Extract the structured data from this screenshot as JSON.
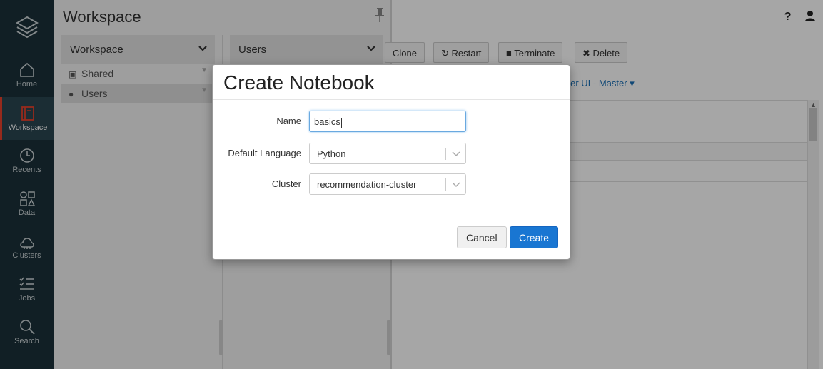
{
  "nav": {
    "items": [
      {
        "label": "Home",
        "icon": "home-icon"
      },
      {
        "label": "Workspace",
        "icon": "workspace-icon"
      },
      {
        "label": "Recents",
        "icon": "clock-icon"
      },
      {
        "label": "Data",
        "icon": "data-icon"
      },
      {
        "label": "Clusters",
        "icon": "cluster-icon"
      },
      {
        "label": "Jobs",
        "icon": "jobs-icon"
      },
      {
        "label": "Search",
        "icon": "search-icon"
      }
    ],
    "active": "Workspace",
    "accent_color": "#e8412c",
    "background_color": "#1b3139"
  },
  "workspace": {
    "title": "Workspace",
    "col1": {
      "header": "Workspace",
      "items": [
        {
          "label": "Shared",
          "icon": "share-icon"
        },
        {
          "label": "Users",
          "icon": "users-icon"
        }
      ],
      "selected": "Users"
    },
    "col2": {
      "header": "Users"
    }
  },
  "main": {
    "toolbar": {
      "clone": "Clone",
      "restart": "Restart",
      "terminate": "Terminate",
      "delete": "Delete"
    },
    "cluster_link": "ster UI - Master",
    "top_icons": [
      "help-icon",
      "user-icon"
    ]
  },
  "modal": {
    "title": "Create Notebook",
    "name_label": "Name",
    "name_value": "basics",
    "language_label": "Default Language",
    "language_value": "Python",
    "cluster_label": "Cluster",
    "cluster_value": "recommendation-cluster",
    "cancel_label": "Cancel",
    "create_label": "Create",
    "primary_color": "#1976d2"
  }
}
